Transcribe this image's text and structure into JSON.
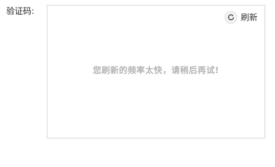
{
  "captcha": {
    "label": "验证码:",
    "refresh_label": "刷新",
    "refresh_icon": "refresh-icon",
    "message": "您刷新的频率太快，请稍后再试!"
  }
}
